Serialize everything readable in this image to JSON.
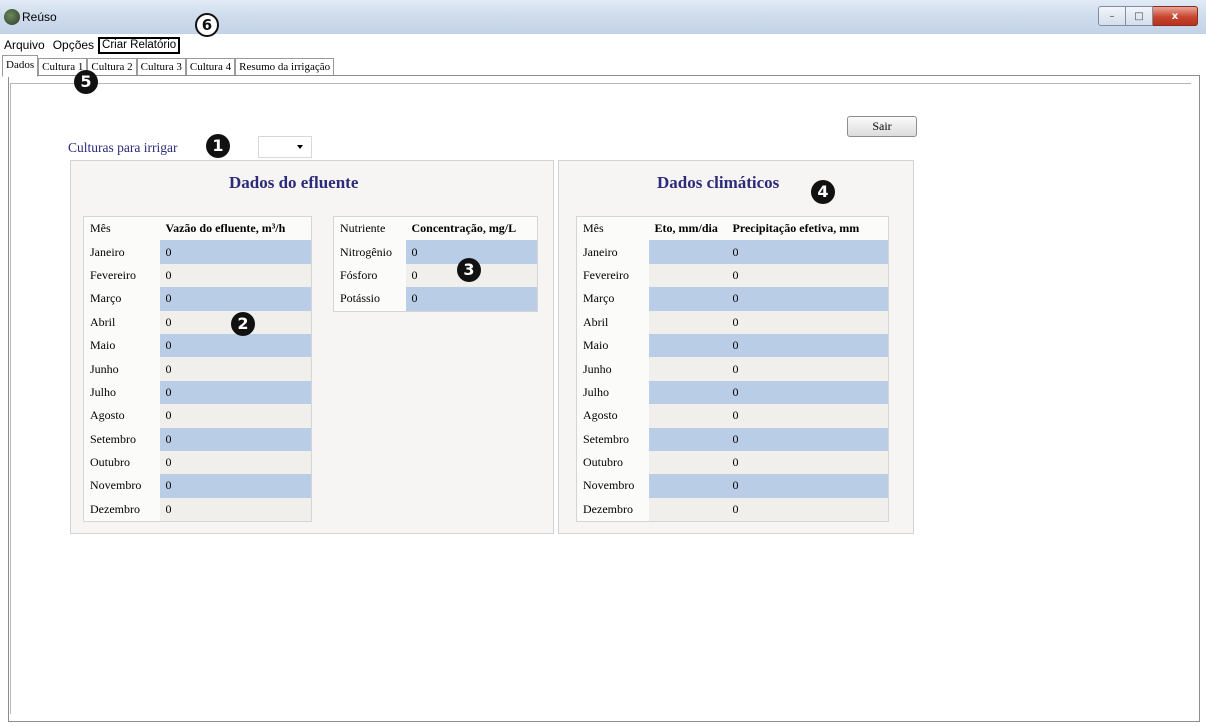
{
  "window": {
    "title": "Reúso",
    "controls": {
      "minimize": "–",
      "maximize": "□",
      "close": "x"
    }
  },
  "menu": {
    "items": [
      "Arquivo",
      "Opções",
      "Criar Relatório"
    ]
  },
  "tabs": [
    "Dados",
    "Cultura 1",
    "Cultura 2",
    "Cultura 3",
    "Cultura 4",
    "Resumo da irrigação"
  ],
  "crops": {
    "label": "Culturas para irrigar",
    "selected": ""
  },
  "exit_button": "Sair",
  "effluent": {
    "title": "Dados do efluente",
    "flow_table": {
      "headers": [
        "Mês",
        "Vazão do efluente, m³/h"
      ],
      "rows": [
        [
          "Janeiro",
          "0"
        ],
        [
          "Fevereiro",
          "0"
        ],
        [
          "Março",
          "0"
        ],
        [
          "Abril",
          "0"
        ],
        [
          "Maio",
          "0"
        ],
        [
          "Junho",
          "0"
        ],
        [
          "Julho",
          "0"
        ],
        [
          "Agosto",
          "0"
        ],
        [
          "Setembro",
          "0"
        ],
        [
          "Outubro",
          "0"
        ],
        [
          "Novembro",
          "0"
        ],
        [
          "Dezembro",
          "0"
        ]
      ]
    },
    "nutrient_table": {
      "headers": [
        "Nutriente",
        "Concentração, mg/L"
      ],
      "rows": [
        [
          "Nitrogênio",
          "0"
        ],
        [
          "Fósforo",
          "0"
        ],
        [
          "Potássio",
          "0"
        ]
      ]
    }
  },
  "climate": {
    "title": "Dados climáticos",
    "headers": [
      "Mês",
      "Eto, mm/dia",
      "Precipitação efetiva, mm"
    ],
    "rows": [
      [
        "Janeiro",
        "",
        "0"
      ],
      [
        "Fevereiro",
        "",
        "0"
      ],
      [
        "Março",
        "",
        "0"
      ],
      [
        "Abril",
        "",
        "0"
      ],
      [
        "Maio",
        "",
        "0"
      ],
      [
        "Junho",
        "",
        "0"
      ],
      [
        "Julho",
        "",
        "0"
      ],
      [
        "Agosto",
        "",
        "0"
      ],
      [
        "Setembro",
        "",
        "0"
      ],
      [
        "Outubro",
        "",
        "0"
      ],
      [
        "Novembro",
        "",
        "0"
      ],
      [
        "Dezembro",
        "",
        "0"
      ]
    ]
  },
  "markers": [
    "1",
    "2",
    "3",
    "4",
    "5",
    "6"
  ]
}
